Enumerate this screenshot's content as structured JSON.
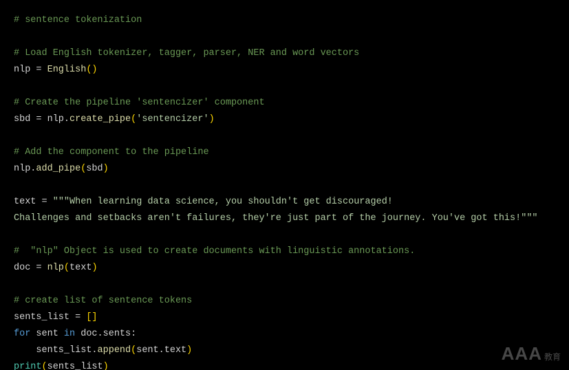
{
  "code": {
    "lines": [
      [
        {
          "cls": "tok-comment",
          "text": "# sentence tokenization"
        }
      ],
      [
        {
          "cls": "tok-default",
          "text": ""
        }
      ],
      [
        {
          "cls": "tok-comment",
          "text": "# Load English tokenizer, tagger, parser, NER and word vectors"
        }
      ],
      [
        {
          "cls": "tok-default",
          "text": "nlp = "
        },
        {
          "cls": "tok-func",
          "text": "English"
        },
        {
          "cls": "tok-paren",
          "text": "()"
        }
      ],
      [
        {
          "cls": "tok-default",
          "text": ""
        }
      ],
      [
        {
          "cls": "tok-comment",
          "text": "# Create the pipeline 'sentencizer' component"
        }
      ],
      [
        {
          "cls": "tok-default",
          "text": "sbd = nlp."
        },
        {
          "cls": "tok-func",
          "text": "create_pipe"
        },
        {
          "cls": "tok-paren",
          "text": "("
        },
        {
          "cls": "tok-string",
          "text": "'sentencizer'"
        },
        {
          "cls": "tok-paren",
          "text": ")"
        }
      ],
      [
        {
          "cls": "tok-default",
          "text": ""
        }
      ],
      [
        {
          "cls": "tok-comment",
          "text": "# Add the component to the pipeline"
        }
      ],
      [
        {
          "cls": "tok-default",
          "text": "nlp."
        },
        {
          "cls": "tok-func",
          "text": "add_pipe"
        },
        {
          "cls": "tok-paren",
          "text": "("
        },
        {
          "cls": "tok-default",
          "text": "sbd"
        },
        {
          "cls": "tok-paren",
          "text": ")"
        }
      ],
      [
        {
          "cls": "tok-default",
          "text": ""
        }
      ],
      [
        {
          "cls": "tok-default",
          "text": "text = "
        },
        {
          "cls": "tok-string",
          "text": "\"\"\"When learning data science, you shouldn't get discouraged!"
        }
      ],
      [
        {
          "cls": "tok-string",
          "text": "Challenges and setbacks aren't failures, they're just part of the journey. You've got this!\"\"\""
        }
      ],
      [
        {
          "cls": "tok-default",
          "text": ""
        }
      ],
      [
        {
          "cls": "tok-comment",
          "text": "#  \"nlp\" Object is used to create documents with linguistic annotations."
        }
      ],
      [
        {
          "cls": "tok-default",
          "text": "doc = "
        },
        {
          "cls": "tok-func",
          "text": "nlp"
        },
        {
          "cls": "tok-paren",
          "text": "("
        },
        {
          "cls": "tok-default",
          "text": "text"
        },
        {
          "cls": "tok-paren",
          "text": ")"
        }
      ],
      [
        {
          "cls": "tok-default",
          "text": ""
        }
      ],
      [
        {
          "cls": "tok-comment",
          "text": "# create list of sentence tokens"
        }
      ],
      [
        {
          "cls": "tok-default",
          "text": "sents_list = "
        },
        {
          "cls": "tok-paren",
          "text": "[]"
        }
      ],
      [
        {
          "cls": "tok-keyword",
          "text": "for"
        },
        {
          "cls": "tok-default",
          "text": " sent "
        },
        {
          "cls": "tok-keyword",
          "text": "in"
        },
        {
          "cls": "tok-default",
          "text": " doc.sents:"
        }
      ],
      [
        {
          "cls": "tok-default",
          "text": "    sents_list."
        },
        {
          "cls": "tok-func",
          "text": "append"
        },
        {
          "cls": "tok-paren",
          "text": "("
        },
        {
          "cls": "tok-default",
          "text": "sent.text"
        },
        {
          "cls": "tok-paren",
          "text": ")"
        }
      ],
      [
        {
          "cls": "tok-builtin",
          "text": "print"
        },
        {
          "cls": "tok-paren",
          "text": "("
        },
        {
          "cls": "tok-default",
          "text": "sents_list"
        },
        {
          "cls": "tok-paren",
          "text": ")"
        }
      ]
    ]
  },
  "watermark": {
    "big": "AAA",
    "small": "教育"
  }
}
